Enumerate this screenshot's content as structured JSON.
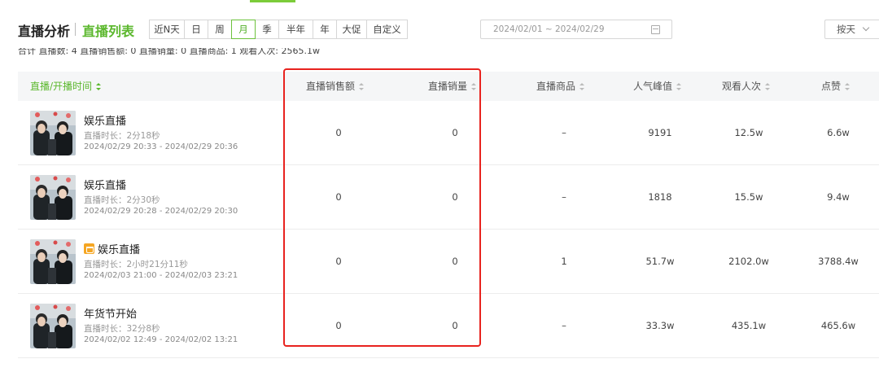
{
  "header": {
    "title": "直播分析",
    "subtitle": "直播列表"
  },
  "periods": [
    {
      "label": "近N天",
      "active": false
    },
    {
      "label": "日",
      "active": false
    },
    {
      "label": "周",
      "active": false
    },
    {
      "label": "月",
      "active": true
    },
    {
      "label": "季",
      "active": false
    },
    {
      "label": "半年",
      "active": false
    },
    {
      "label": "年",
      "active": false
    },
    {
      "label": "大促",
      "active": false
    },
    {
      "label": "自定义",
      "active": false
    }
  ],
  "date_range": "2024/02/01 ~ 2024/02/29",
  "granularity_select": "按天",
  "summary": "合计 直播数: 4 直播销售额: 0 直播销量: 0 直播商品: 1 观看人次: 2565.1w",
  "columns": {
    "time": "直播/开播时间",
    "sales_amount": "直播销售额",
    "sales_volume": "直播销量",
    "products": "直播商品",
    "peak": "人气峰值",
    "views": "观看人次",
    "likes": "点赞"
  },
  "rows": [
    {
      "title": "娱乐直播",
      "has_shop_icon": false,
      "duration": "直播时长：2分18秒",
      "time_range": "2024/02/29 20:33 - 2024/02/29 20:36",
      "sales_amount": "0",
      "sales_volume": "0",
      "products": "–",
      "peak": "9191",
      "views": "12.5w",
      "likes": "6.6w"
    },
    {
      "title": "娱乐直播",
      "has_shop_icon": false,
      "duration": "直播时长：2分30秒",
      "time_range": "2024/02/29 20:28 - 2024/02/29 20:30",
      "sales_amount": "0",
      "sales_volume": "0",
      "products": "–",
      "peak": "1818",
      "views": "15.5w",
      "likes": "9.4w"
    },
    {
      "title": "娱乐直播",
      "has_shop_icon": true,
      "duration": "直播时长：2小时21分11秒",
      "time_range": "2024/02/03 21:00 - 2024/02/03 23:21",
      "sales_amount": "0",
      "sales_volume": "0",
      "products": "1",
      "peak": "51.7w",
      "views": "2102.0w",
      "likes": "3788.4w"
    },
    {
      "title": "年货节开始",
      "has_shop_icon": false,
      "duration": "直播时长：32分8秒",
      "time_range": "2024/02/02 12:49 - 2024/02/02 13:21",
      "sales_amount": "0",
      "sales_volume": "0",
      "products": "–",
      "peak": "33.3w",
      "views": "435.1w",
      "likes": "465.6w"
    }
  ],
  "colors": {
    "accent_green": "#5cb82e",
    "highlight_red": "#e8231f"
  },
  "icons": [
    "calendar-icon",
    "chevron-down-icon",
    "sort-icon",
    "shop-bag-icon"
  ]
}
